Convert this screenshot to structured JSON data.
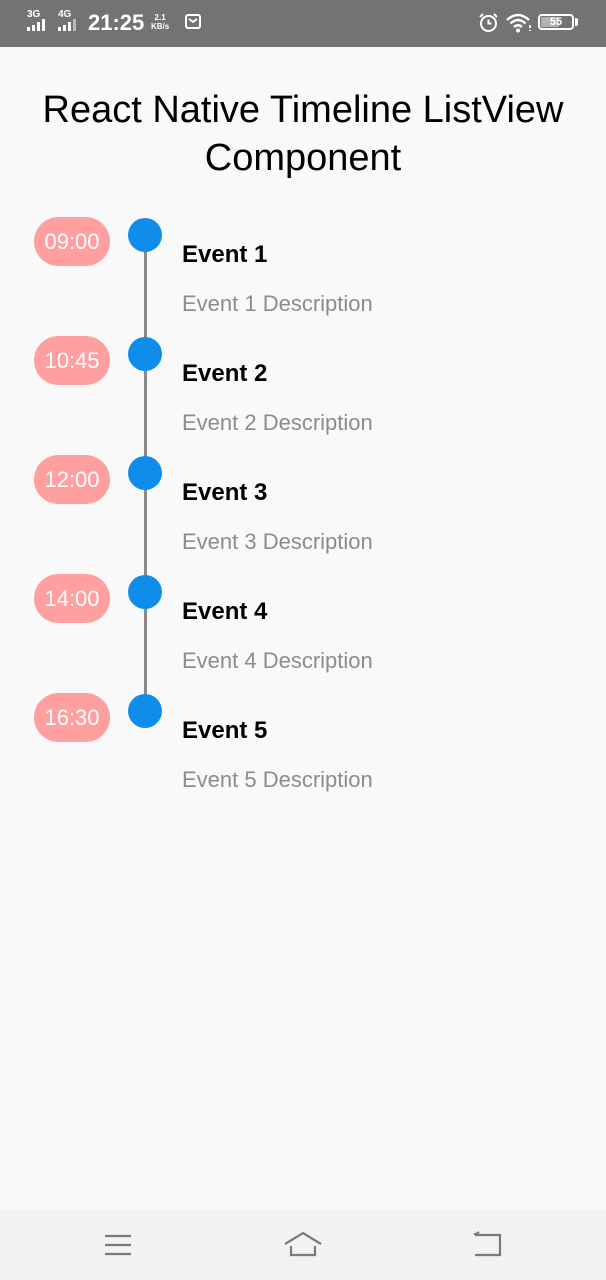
{
  "status_bar": {
    "network_1": "3G",
    "network_2": "4G",
    "time": "21:25",
    "speed_value": "2.1",
    "speed_unit": "KB/s",
    "battery_level": "55",
    "battery_fraction": 0.55,
    "icons": [
      "signal-icon",
      "signal-icon",
      "mail-icon",
      "alarm-icon",
      "wifi-icon",
      "battery-icon"
    ]
  },
  "page": {
    "title_line1": "React Native Timeline ListView",
    "title_line2": "Component"
  },
  "timeline": {
    "colors": {
      "time_pill": "#ff9f9f",
      "dot": "#0f8deb",
      "line": "#8a8a8a",
      "description": "#8c8c8c"
    },
    "events": [
      {
        "time": "09:00",
        "title": "Event 1",
        "description": "Event 1 Description"
      },
      {
        "time": "10:45",
        "title": "Event 2",
        "description": "Event 2 Description"
      },
      {
        "time": "12:00",
        "title": "Event 3",
        "description": "Event 3 Description"
      },
      {
        "time": "14:00",
        "title": "Event 4",
        "description": "Event 4 Description"
      },
      {
        "time": "16:30",
        "title": "Event 5",
        "description": "Event 5 Description"
      }
    ]
  },
  "nav_bar": {
    "buttons": [
      "menu-icon",
      "home-icon",
      "back-icon"
    ]
  }
}
